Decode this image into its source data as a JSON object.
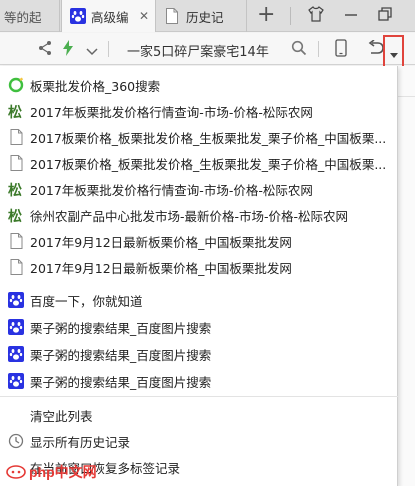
{
  "tabs": [
    {
      "label": "等的起",
      "icon": "page-icon"
    },
    {
      "label": "高级编",
      "icon": "baidu-paw-icon",
      "active": true
    },
    {
      "label": "历史记",
      "icon": "page-icon"
    }
  ],
  "toolbar": {
    "address_text": "一家5口碎尸案豪宅14年",
    "right_edge_text": "三"
  },
  "menu": {
    "items": [
      {
        "label": "板栗批发价格_360搜索",
        "icon": "360-search-icon"
      },
      {
        "label": "2017年板栗批发价格行情查询-市场-价格-松际农网",
        "icon": "songji-icon"
      },
      {
        "label": "2017板栗价格_板栗批发价格_生板栗批发_栗子价格_中国板栗...",
        "icon": "page-icon"
      },
      {
        "label": "2017板栗价格_板栗批发价格_生板栗批发_栗子价格_中国板栗...",
        "icon": "page-icon"
      },
      {
        "label": "2017年板栗批发价格行情查询-市场-价格-松际农网",
        "icon": "songji-icon"
      },
      {
        "label": "徐州农副产品中心批发市场-最新价格-市场-价格-松际农网",
        "icon": "songji-icon"
      },
      {
        "label": "2017年9月12日最新板栗价格_中国板栗批发网",
        "icon": "page-icon"
      },
      {
        "label": "2017年9月12日最新板栗价格_中国板栗批发网",
        "icon": "page-icon"
      },
      {
        "label": "百度一下，你就知道",
        "icon": "baidu-paw-icon"
      },
      {
        "label": "栗子粥的搜索结果_百度图片搜索",
        "icon": "baidu-paw-icon"
      },
      {
        "label": "栗子粥的搜索结果_百度图片搜索",
        "icon": "baidu-paw-icon"
      },
      {
        "label": "栗子粥的搜索结果_百度图片搜索",
        "icon": "baidu-paw-icon"
      }
    ],
    "clear_label": "清空此列表",
    "show_history_label": "显示所有历史记录",
    "restore_label": "在当前窗口恢复多标签记录"
  },
  "watermark": {
    "text": "php中文网"
  },
  "colors": {
    "highlight": "#e0443c",
    "baidu_blue": "#2932e1",
    "songji_green": "#3c7a2a",
    "bolt_green": "#4caf50",
    "search_360_green": "#3fbf3f"
  }
}
